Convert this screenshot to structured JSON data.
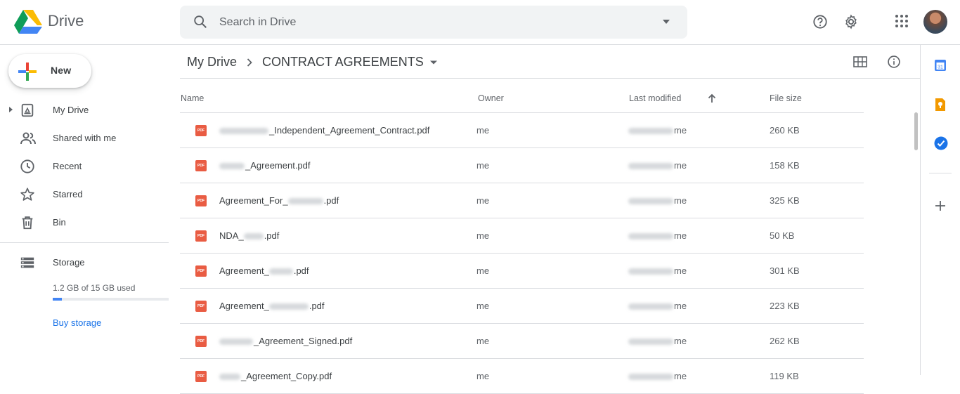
{
  "app": {
    "name": "Drive"
  },
  "search": {
    "placeholder": "Search in Drive"
  },
  "sidebar": {
    "new_label": "New",
    "items": [
      {
        "label": "My Drive",
        "icon": "my-drive-icon"
      },
      {
        "label": "Shared with me",
        "icon": "people-icon"
      },
      {
        "label": "Recent",
        "icon": "clock-icon"
      },
      {
        "label": "Starred",
        "icon": "star-icon"
      },
      {
        "label": "Bin",
        "icon": "trash-icon"
      }
    ],
    "storage": {
      "label": "Storage",
      "used_text": "1.2 GB of 15 GB used",
      "used_fraction": 0.08,
      "buy_label": "Buy storage"
    }
  },
  "breadcrumb": {
    "root": "My Drive",
    "current": "CONTRACT AGREEMENTS"
  },
  "table": {
    "headers": {
      "name": "Name",
      "owner": "Owner",
      "modified": "Last modified",
      "size": "File size"
    },
    "rows": [
      {
        "name": "_Independent_Agreement_Contract.pdf",
        "owner": "me",
        "modified_owner": "me",
        "size": "260 KB"
      },
      {
        "name": "_Agreement.pdf",
        "owner": "me",
        "modified_owner": "me",
        "size": "158 KB"
      },
      {
        "name": "Agreement_For_",
        "name_suffix": ".pdf",
        "owner": "me",
        "modified_owner": "me",
        "size": "325 KB"
      },
      {
        "name": "NDA_",
        "name_suffix": ".pdf",
        "owner": "me",
        "modified_owner": "me",
        "size": "50 KB"
      },
      {
        "name": "Agreement_",
        "name_suffix": ".pdf",
        "owner": "me",
        "modified_owner": "me",
        "size": "301 KB"
      },
      {
        "name": "Agreement_",
        "name_suffix": ".pdf",
        "owner": "me",
        "modified_owner": "me",
        "size": "223 KB"
      },
      {
        "name": "_Agreement_Signed.pdf",
        "owner": "me",
        "modified_owner": "me",
        "size": "262 KB"
      },
      {
        "name": "_Agreement_Copy.pdf",
        "owner": "me",
        "modified_owner": "me",
        "size": "119 KB"
      }
    ]
  },
  "colors": {
    "accent": "#1a73e8",
    "pdf": "#e95c43",
    "divider": "#dadce0"
  }
}
